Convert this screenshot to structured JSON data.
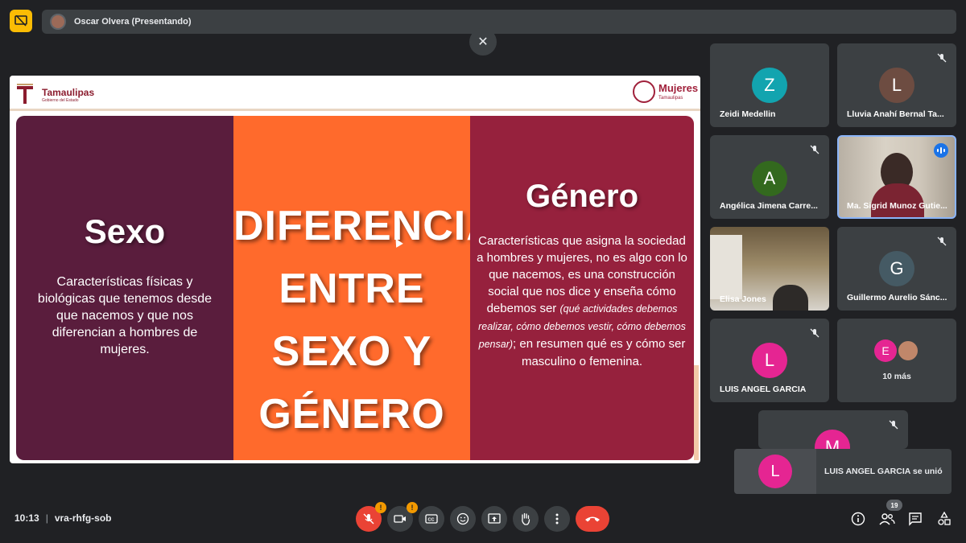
{
  "presenter": {
    "name": "Oscar Olvera (Presentando)"
  },
  "slide": {
    "left_logo": "Tamaulipas",
    "left_logo_sub": "Gobierno del Estado",
    "right_logo": "Mujeres",
    "right_logo_sub": "Tamaulipas",
    "left_title": "Sexo",
    "left_text": "Características físicas y biológicas que tenemos desde que nacemos y que nos diferencian a hombres de mujeres.",
    "center_title": "DIFERENCIA ENTRE SEXO Y GÉNERO",
    "right_title": "Género",
    "right_text_a": "Características que asigna la sociedad a hombres y mujeres, no es algo con lo que nacemos, es una construcción social que nos dice y enseña cómo debemos ser",
    "right_text_italic": "(qué actividades debemos realizar, cómo debemos vestir, cómo debemos pensar)",
    "right_text_b": "; en resumen qué es y cómo ser masculino o femenina."
  },
  "participants": [
    {
      "initial": "Z",
      "name": "Zeidi Medellin",
      "color": "#12a4af"
    },
    {
      "initial": "L",
      "name": "Lluvia Anahí Bernal Ta...",
      "color": "#6d4c41"
    },
    {
      "initial": "A",
      "name": "Angélica Jimena Carre...",
      "color": "#33691e"
    },
    {
      "initial": "",
      "name": "Ma. Sigrid Munoz Gutie..."
    },
    {
      "initial": "",
      "name": "Elisa Jones"
    },
    {
      "initial": "G",
      "name": "Guillermo Aurelio Sánc...",
      "color": "#455a64"
    },
    {
      "initial": "L",
      "name": "LUIS ANGEL GARCIA",
      "color": "#e52592"
    },
    {
      "initial": "E",
      "more_label": "10 más",
      "color": "#e52592"
    },
    {
      "initial": "M",
      "color": "#e52592"
    }
  ],
  "toast": {
    "initial": "L",
    "text": "LUIS ANGEL GARCIA se unió",
    "color": "#e52592"
  },
  "meeting": {
    "time": "10:13",
    "code": "vra-rhfg-sob"
  },
  "controls": {
    "mic_badge": "!",
    "cam_badge": "!",
    "people_count": "19"
  }
}
